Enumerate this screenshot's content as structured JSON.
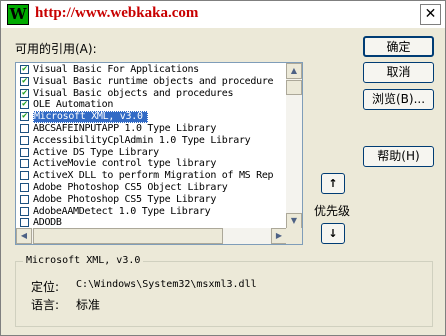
{
  "titlebar": {
    "logo_letter": "W",
    "url": "http://www.webkaka.com",
    "close_label": "✕"
  },
  "available_refs_label": "可用的引用(A):",
  "references": [
    {
      "label": "Visual Basic For Applications",
      "checked": true
    },
    {
      "label": "Visual Basic runtime objects and procedure",
      "checked": true
    },
    {
      "label": "Visual Basic objects and procedures",
      "checked": true
    },
    {
      "label": "OLE Automation",
      "checked": true
    },
    {
      "label": "Microsoft XML, v3.0",
      "checked": true,
      "selected": true
    },
    {
      "label": "ABCSAFEINPUTAPP 1.0 Type Library",
      "checked": false
    },
    {
      "label": "AccessibilityCplAdmin 1.0 Type Library",
      "checked": false
    },
    {
      "label": "Active DS Type Library",
      "checked": false
    },
    {
      "label": "ActiveMovie control type library",
      "checked": false
    },
    {
      "label": "ActiveX DLL to perform Migration of MS Rep",
      "checked": false
    },
    {
      "label": "Adobe Photoshop CS5 Object Library",
      "checked": false
    },
    {
      "label": "Adobe Photoshop CS5 Type Library",
      "checked": false
    },
    {
      "label": "AdobeAAMDetect 1.0 Type Library",
      "checked": false
    },
    {
      "label": "ADODB",
      "checked": false
    }
  ],
  "buttons": {
    "ok": "确定",
    "cancel": "取消",
    "browse": "浏览(B)...",
    "help": "帮助(H)"
  },
  "priority": {
    "label": "优先级",
    "up": "↑",
    "down": "↓"
  },
  "details": {
    "group_title": "Microsoft XML, v3.0",
    "location_label": "定位:",
    "location_value": "C:\\Windows\\System32\\msxml3.dll",
    "language_label": "语言:",
    "language_value": "标准"
  }
}
